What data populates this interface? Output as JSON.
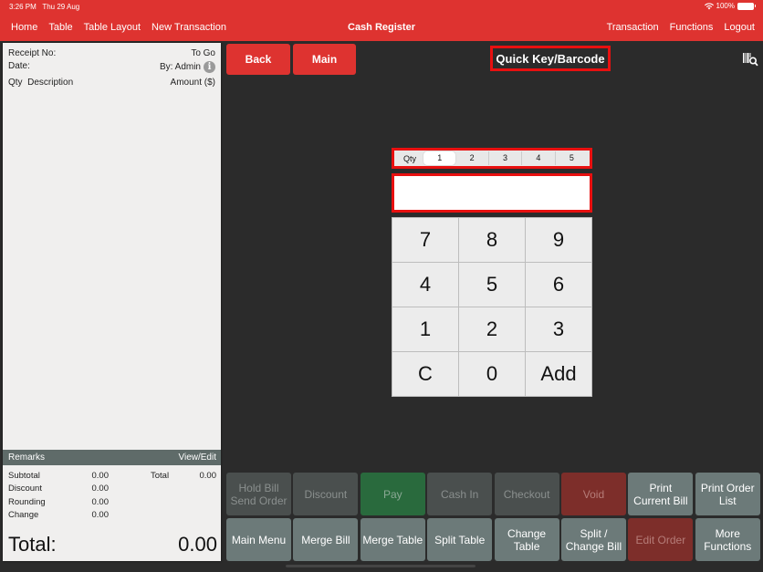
{
  "status_bar": {
    "time": "3:26 PM",
    "date": "Thu 29 Aug",
    "battery": "100%"
  },
  "nav": {
    "left": [
      "Home",
      "Table",
      "Table Layout",
      "New Transaction"
    ],
    "title": "Cash Register",
    "right": [
      "Transaction",
      "Functions",
      "Logout"
    ]
  },
  "receipt": {
    "receipt_no_label": "Receipt No:",
    "order_type": "To Go",
    "date_label": "Date:",
    "by_label": "By: Admin",
    "qty_header": "Qty",
    "description_header": "Description",
    "amount_header": "Amount ($)",
    "remarks_label": "Remarks",
    "remarks_action": "View/Edit",
    "subtotal_label": "Subtotal",
    "subtotal": "0.00",
    "total_label": "Total",
    "total": "0.00",
    "discount_label": "Discount",
    "discount": "0.00",
    "rounding_label": "Rounding",
    "rounding": "0.00",
    "change_label": "Change",
    "change": "0.00",
    "grand_total_label": "Total:",
    "grand_total": "0.00"
  },
  "toolbar": {
    "back": "Back",
    "main": "Main",
    "mode_title": "Quick Key/Barcode"
  },
  "qty_selector": {
    "label": "Qty",
    "options": [
      "1",
      "2",
      "3",
      "4",
      "5"
    ],
    "selected": "1"
  },
  "quick_key_input": {
    "value": ""
  },
  "keypad": [
    "7",
    "8",
    "9",
    "4",
    "5",
    "6",
    "1",
    "2",
    "3",
    "C",
    "0",
    "Add"
  ],
  "function_buttons": [
    {
      "label": "Hold Bill\nSend Order",
      "state": "disabled"
    },
    {
      "label": "Discount",
      "state": "disabled"
    },
    {
      "label": "Pay",
      "state": "pay"
    },
    {
      "label": "Cash In",
      "state": "disabled"
    },
    {
      "label": "Checkout",
      "state": "disabled"
    },
    {
      "label": "Void",
      "state": "void"
    },
    {
      "label": "Print\nCurrent Bill",
      "state": "enabled"
    },
    {
      "label": "Print Order\nList",
      "state": "enabled"
    },
    {
      "label": "Main Menu",
      "state": "enabled"
    },
    {
      "label": "Merge Bill",
      "state": "enabled"
    },
    {
      "label": "Merge Table",
      "state": "enabled"
    },
    {
      "label": "Split Table",
      "state": "enabled"
    },
    {
      "label": "Change\nTable",
      "state": "enabled"
    },
    {
      "label": "Split /\nChange Bill",
      "state": "enabled"
    },
    {
      "label": "Edit Order",
      "state": "void"
    },
    {
      "label": "More\nFunctions",
      "state": "enabled"
    }
  ],
  "colors": {
    "brand_red": "#de3330",
    "highlight_red": "#e81010",
    "pay_green": "#296a3d",
    "void_red": "#7d2e2a"
  }
}
